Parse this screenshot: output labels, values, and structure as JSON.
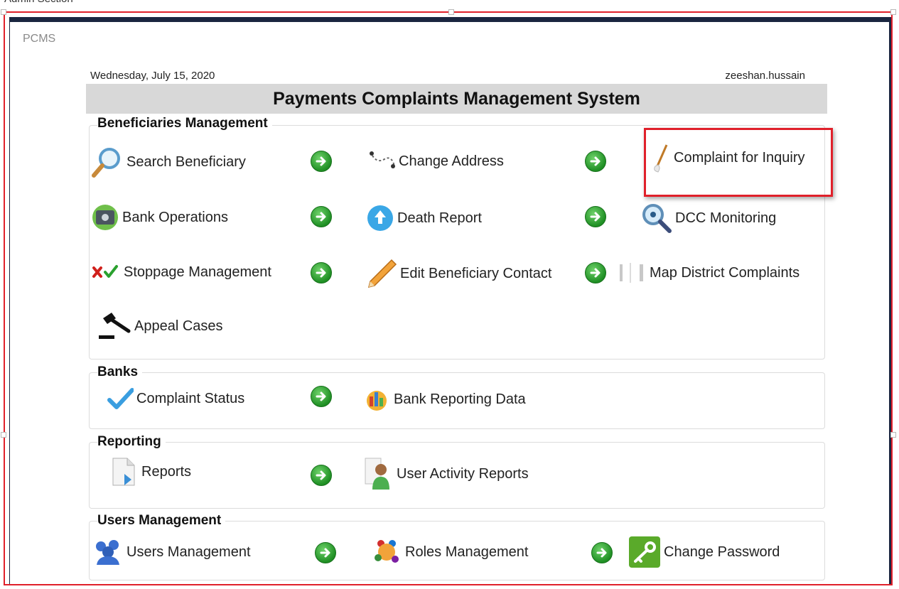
{
  "app": {
    "label": "PCMS",
    "date": "Wednesday, July 15, 2020",
    "user": "zeeshan.hussain",
    "title": "Payments Complaints Management System"
  },
  "colors": {
    "highlight": "#e0202a",
    "frame": "#1a2640",
    "title_bar": "#d8d8d8",
    "arrow_green": "#2aa12f"
  },
  "groups": {
    "beneficiaries": {
      "title": "Beneficiaries Management",
      "items": [
        {
          "label": "Search Beneficiary",
          "icon": "magnifier-icon"
        },
        {
          "label": "Change Address",
          "icon": "route-icon"
        },
        {
          "label": "Complaint for Inquiry",
          "icon": "quill-icon"
        },
        {
          "label": "Bank Operations",
          "icon": "safe-icon"
        },
        {
          "label": "Death Report",
          "icon": "upload-icon"
        },
        {
          "label": "DCC Monitoring",
          "icon": "zoom-icon"
        },
        {
          "label": "Stoppage Management",
          "icon": "cross-check-icon"
        },
        {
          "label": "Edit Beneficiary Contact",
          "icon": "pencil-icon"
        },
        {
          "label": "Map District Complaints",
          "icon": "columns-icon"
        },
        {
          "label": "Appeal Cases",
          "icon": "gavel-icon"
        }
      ]
    },
    "banks": {
      "title": "Banks",
      "items": [
        {
          "label": "Complaint Status",
          "icon": "checkmark-icon"
        },
        {
          "label": "Bank Reporting Data",
          "icon": "chart-coins-icon"
        }
      ]
    },
    "reporting": {
      "title": "Reporting",
      "items": [
        {
          "label": "Reports",
          "icon": "document-icon"
        },
        {
          "label": "User Activity Reports",
          "icon": "user-report-icon"
        }
      ]
    },
    "users": {
      "title": "Users Management",
      "items": [
        {
          "label": "Users Management",
          "icon": "users-icon"
        },
        {
          "label": "Roles Management",
          "icon": "roles-icon"
        },
        {
          "label": "Change Password",
          "icon": "key-icon"
        }
      ]
    }
  }
}
